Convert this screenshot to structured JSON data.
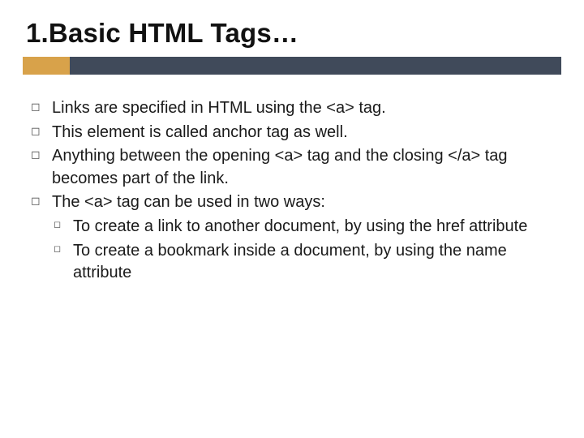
{
  "title": "1.Basic HTML Tags…",
  "bullets": [
    {
      "text": "Links are specified in HTML using the <a> tag."
    },
    {
      "text": "This element is called anchor tag as well."
    },
    {
      "text": "Anything between the opening <a> tag and the closing </a> tag becomes part of the link."
    },
    {
      "text": "The <a> tag can be used in two ways:",
      "sub": [
        "To create a link to another document, by using the href attribute",
        "To create a bookmark inside a document, by using the name attribute"
      ]
    }
  ],
  "accent": {
    "bar_color": "#404a5a",
    "chip_color": "#d8a24a"
  }
}
